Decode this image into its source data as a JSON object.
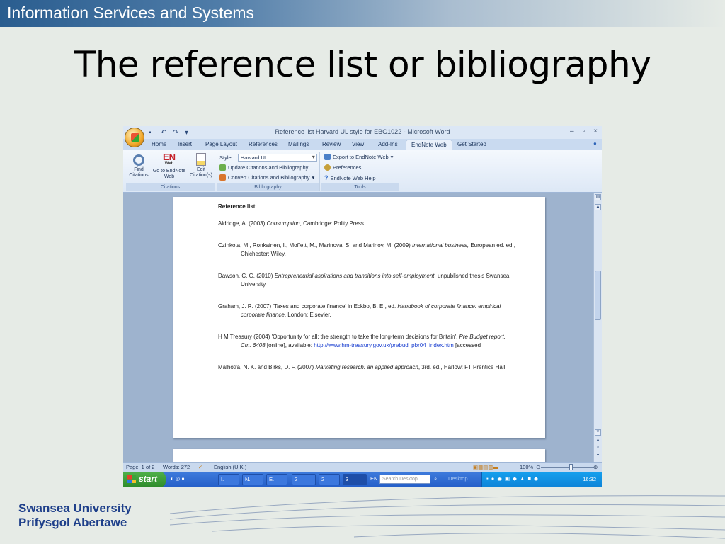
{
  "slide": {
    "header_band": "Information Services and Systems",
    "title": "The reference list or bibliography",
    "footer_line1": "Swansea University",
    "footer_line2": "Prifysgol Abertawe"
  },
  "window": {
    "title": "Reference list Harvard UL style for EBG1022 - Microsoft Word"
  },
  "ribbon_tabs": [
    "Home",
    "Insert",
    "Page Layout",
    "References",
    "Mailings",
    "Review",
    "View",
    "Add-Ins",
    "EndNote Web",
    "Get Started"
  ],
  "active_tab": "EndNote Web",
  "ribbon": {
    "find_citations": "Find Citations",
    "go_to_endnote": "Go to EndNote Web",
    "edit_citations": "Edit Citation(s)",
    "en_logo": "EN",
    "en_logo_sub": "Web",
    "group_citations": "Citations",
    "style_label": "Style:",
    "style_value": "Harvard UL",
    "update_citations": "Update Citations and Bibliography",
    "convert_citations": "Convert Citations and Bibliography",
    "group_bibliography": "Bibliography",
    "export": "Export to EndNote Web",
    "preferences": "Preferences",
    "help": "EndNote Web Help",
    "group_tools": "Tools"
  },
  "document": {
    "heading": "Reference list",
    "r1_a": "Aldridge, A. (2003) ",
    "r1_i": "Consumption",
    "r1_b": ", Cambridge: Polity Press.",
    "r2_a": "Czinkota, M., Ronkainen, I., Moffett, M., Marinova, S. and Marinov, M. (2009) ",
    "r2_i": "International business,",
    "r2_b": " European ed. ed., Chichester: Wiley.",
    "r3_a": "Dawson, C. G. (2010) ",
    "r3_i": "Entrepreneurial aspirations and transitions into self-employment",
    "r3_b": ", unpublished thesis Swansea University.",
    "r4_a": "Graham, J. R. (2007) 'Taxes and corporate finance' in Eckbo, B. E., ed. ",
    "r4_i": "Handbook of corporate finance: empirical corporate finance",
    "r4_b": ", London: Elsevier.",
    "r5_a": "H M Treasury (2004) 'Opportunity for all: the strength to take the long-term decisions for Britain', ",
    "r5_i": "Pre Budget report, Cm. 6408",
    "r5_b": " [online], available: ",
    "r5_link": "http://www.hm-treasury.gov.uk/prebud_pbr04_index.htm",
    "r5_c": " [accessed",
    "r6_a": "Malhotra, N. K. and Birks, D. F. (2007) ",
    "r6_i": "Marketing research: an applied approach",
    "r6_b": ", 3rd. ed., Harlow: FT Prentice Hall."
  },
  "status": {
    "page": "Page: 1 of 2",
    "words": "Words: 272",
    "language": "English (U.K.)",
    "zoom": "100%"
  },
  "taskbar": {
    "start": "start",
    "items": [
      "I.",
      "N.",
      "E.",
      "2",
      "2",
      "3"
    ],
    "lang": "EN",
    "search_placeholder": "Search Desktop",
    "desktop": "Desktop",
    "clock": "16:32"
  }
}
